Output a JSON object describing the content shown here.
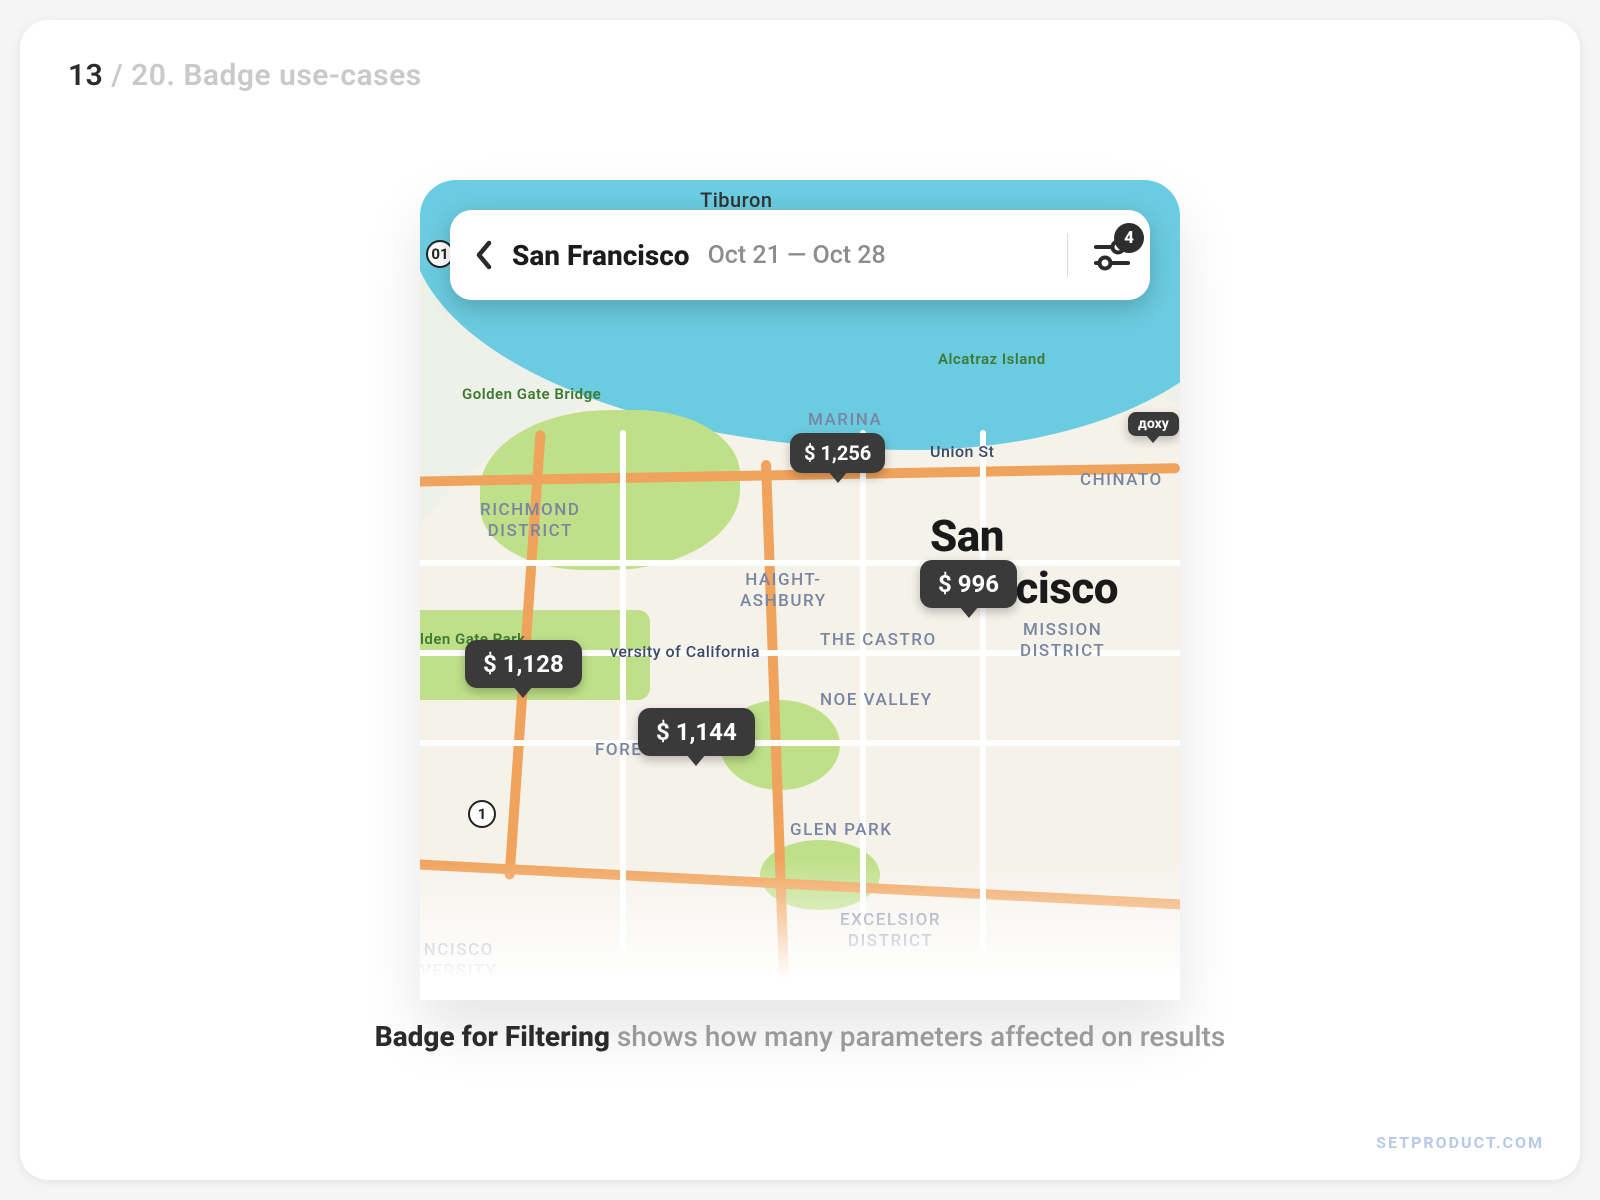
{
  "breadcrumb": {
    "page": "13",
    "total_and_title": " / 20. Badge use-cases"
  },
  "search": {
    "location": "San Francisco",
    "date_range": "Oct 21 — Oct 28",
    "filter_badge_count": "4"
  },
  "city_title": "San Francisco",
  "route_shields": {
    "hwy1": "1",
    "us101": "01"
  },
  "map_labels": {
    "tiburon": "Tiburon",
    "alcatraz": "Alcatraz Island",
    "ggbridge": "Golden Gate Bridge",
    "marina": "MARINA",
    "unionst": "Union St",
    "chinatown": "CHINATO",
    "richmond": "RICHMOND\nDISTRICT",
    "haight": "HAIGHT-\nASHBURY",
    "castro": "THE CASTRO",
    "mission": "MISSION\nDISTRICT",
    "ggpark": "lden Gate Park",
    "noe": "NOE VALLEY",
    "university": "versity of California",
    "foresthill": "FOREST HILL",
    "glenpark": "GLEN PARK",
    "excelsior": "EXCELSIOR\nDISTRICT",
    "sf2": "ncisco\nversity",
    "extra_pin": "доху"
  },
  "prices": {
    "p1": "$ 1,256",
    "p2": "$ 996",
    "p3": "$ 1,128",
    "p4": "$ 1,144"
  },
  "caption": {
    "lead": "Badge for Filtering",
    "rest": " shows how many parameters affected on results"
  },
  "watermark": "SETPRODUCT.COM"
}
